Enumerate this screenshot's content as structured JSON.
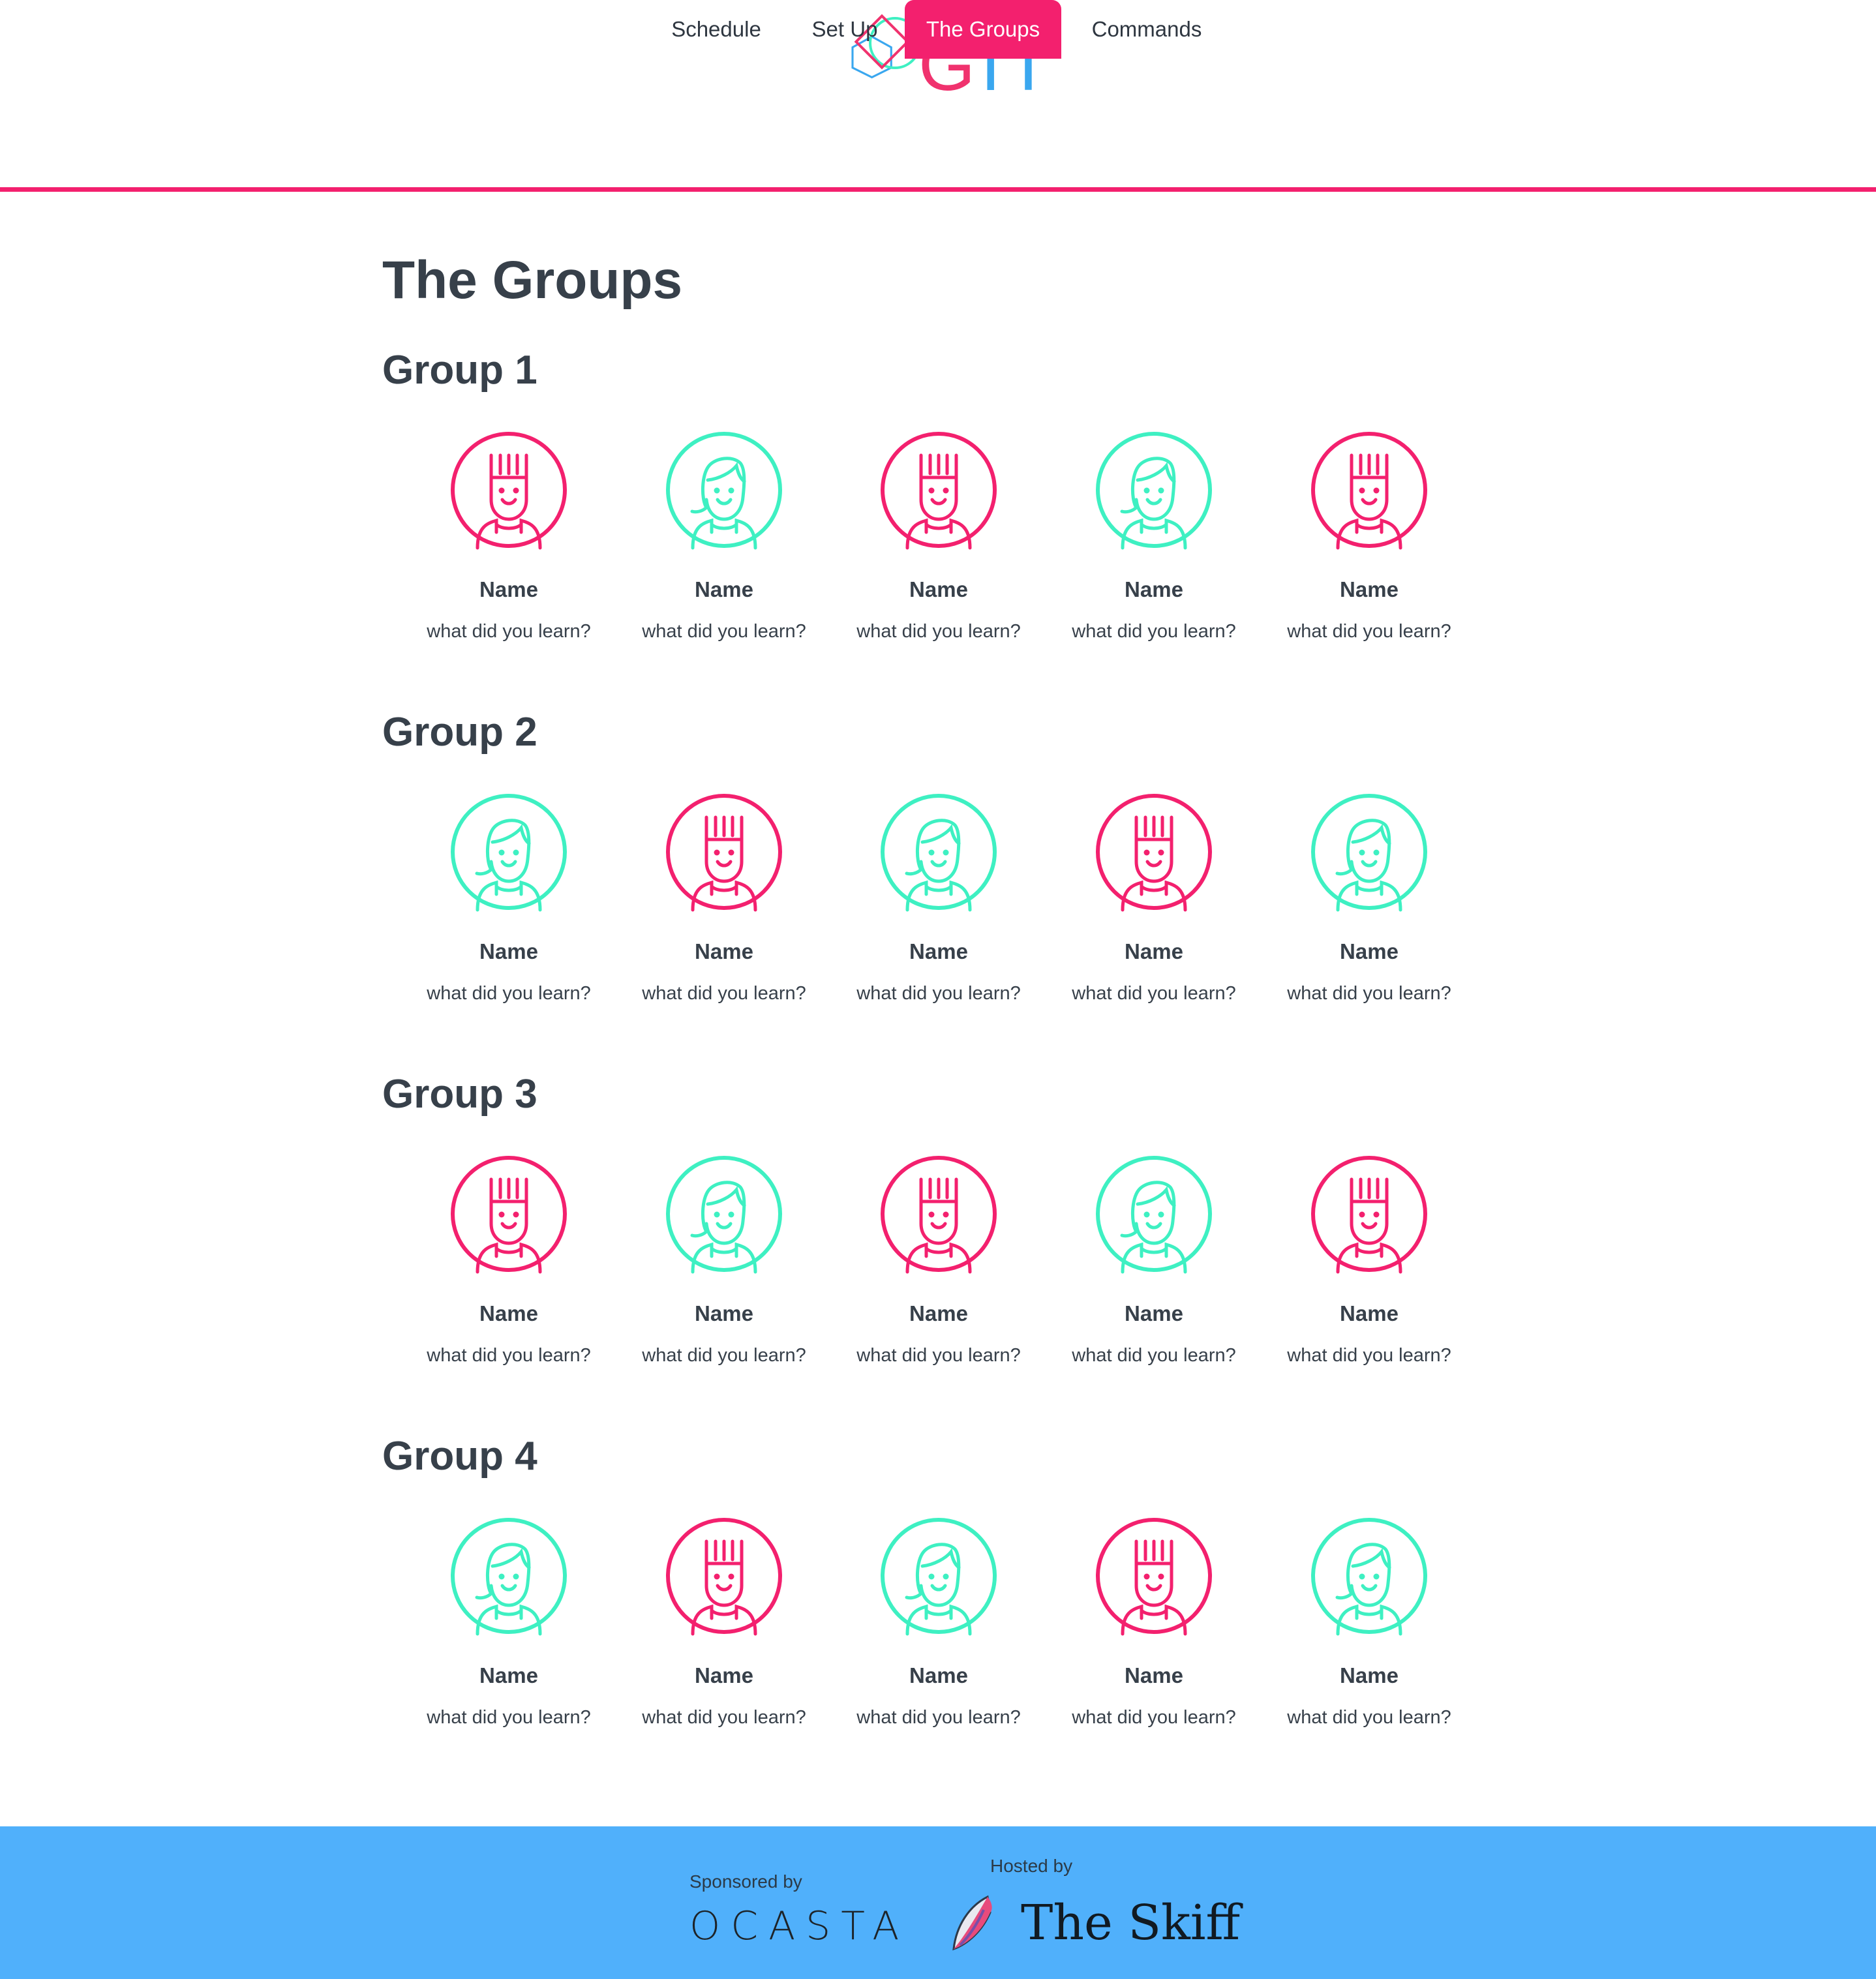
{
  "brand": {
    "logo_part1": "G",
    "logo_part2": "IT",
    "logo_icon": "git-shapes-icon",
    "colors": {
      "pink": "#f3206e",
      "teal": "#3ef0c2",
      "blue": "#3aa7ef",
      "footer": "#50b0fb",
      "text": "#37404a"
    }
  },
  "nav": {
    "tabs": [
      {
        "label": "Schedule",
        "active": false
      },
      {
        "label": "Set Up",
        "active": false
      },
      {
        "label": "The Groups",
        "active": true
      },
      {
        "label": "Commands",
        "active": false
      }
    ]
  },
  "page": {
    "title": "The Groups"
  },
  "groups": [
    {
      "title": "Group 1",
      "members": [
        {
          "name": "Name",
          "learn": "what did you learn?",
          "avatar": "spiky-hair-avatar-icon",
          "color": "pink"
        },
        {
          "name": "Name",
          "learn": "what did you learn?",
          "avatar": "swept-hair-avatar-icon",
          "color": "teal"
        },
        {
          "name": "Name",
          "learn": "what did you learn?",
          "avatar": "spiky-hair-avatar-icon",
          "color": "pink"
        },
        {
          "name": "Name",
          "learn": "what did you learn?",
          "avatar": "swept-hair-avatar-icon",
          "color": "teal"
        },
        {
          "name": "Name",
          "learn": "what did you learn?",
          "avatar": "spiky-hair-avatar-icon",
          "color": "pink"
        }
      ]
    },
    {
      "title": "Group 2",
      "members": [
        {
          "name": "Name",
          "learn": "what did you learn?",
          "avatar": "swept-hair-avatar-icon",
          "color": "teal"
        },
        {
          "name": "Name",
          "learn": "what did you learn?",
          "avatar": "spiky-hair-avatar-icon",
          "color": "pink"
        },
        {
          "name": "Name",
          "learn": "what did you learn?",
          "avatar": "swept-hair-avatar-icon",
          "color": "teal"
        },
        {
          "name": "Name",
          "learn": "what did you learn?",
          "avatar": "spiky-hair-avatar-icon",
          "color": "pink"
        },
        {
          "name": "Name",
          "learn": "what did you learn?",
          "avatar": "swept-hair-avatar-icon",
          "color": "teal"
        }
      ]
    },
    {
      "title": "Group 3",
      "members": [
        {
          "name": "Name",
          "learn": "what did you learn?",
          "avatar": "spiky-hair-avatar-icon",
          "color": "pink"
        },
        {
          "name": "Name",
          "learn": "what did you learn?",
          "avatar": "swept-hair-avatar-icon",
          "color": "teal"
        },
        {
          "name": "Name",
          "learn": "what did you learn?",
          "avatar": "spiky-hair-avatar-icon",
          "color": "pink"
        },
        {
          "name": "Name",
          "learn": "what did you learn?",
          "avatar": "swept-hair-avatar-icon",
          "color": "teal"
        },
        {
          "name": "Name",
          "learn": "what did you learn?",
          "avatar": "spiky-hair-avatar-icon",
          "color": "pink"
        }
      ]
    },
    {
      "title": "Group 4",
      "members": [
        {
          "name": "Name",
          "learn": "what did you learn?",
          "avatar": "swept-hair-avatar-icon",
          "color": "teal"
        },
        {
          "name": "Name",
          "learn": "what did you learn?",
          "avatar": "spiky-hair-avatar-icon",
          "color": "pink"
        },
        {
          "name": "Name",
          "learn": "what did you learn?",
          "avatar": "swept-hair-avatar-icon",
          "color": "teal"
        },
        {
          "name": "Name",
          "learn": "what did you learn?",
          "avatar": "spiky-hair-avatar-icon",
          "color": "pink"
        },
        {
          "name": "Name",
          "learn": "what did you learn?",
          "avatar": "swept-hair-avatar-icon",
          "color": "teal"
        }
      ]
    }
  ],
  "footer": {
    "sponsor_label": "Sponsored by",
    "sponsor_name": "OCASTA",
    "host_label": "Hosted by",
    "host_name": "The Skiff",
    "host_icon": "skiff-boat-icon"
  }
}
